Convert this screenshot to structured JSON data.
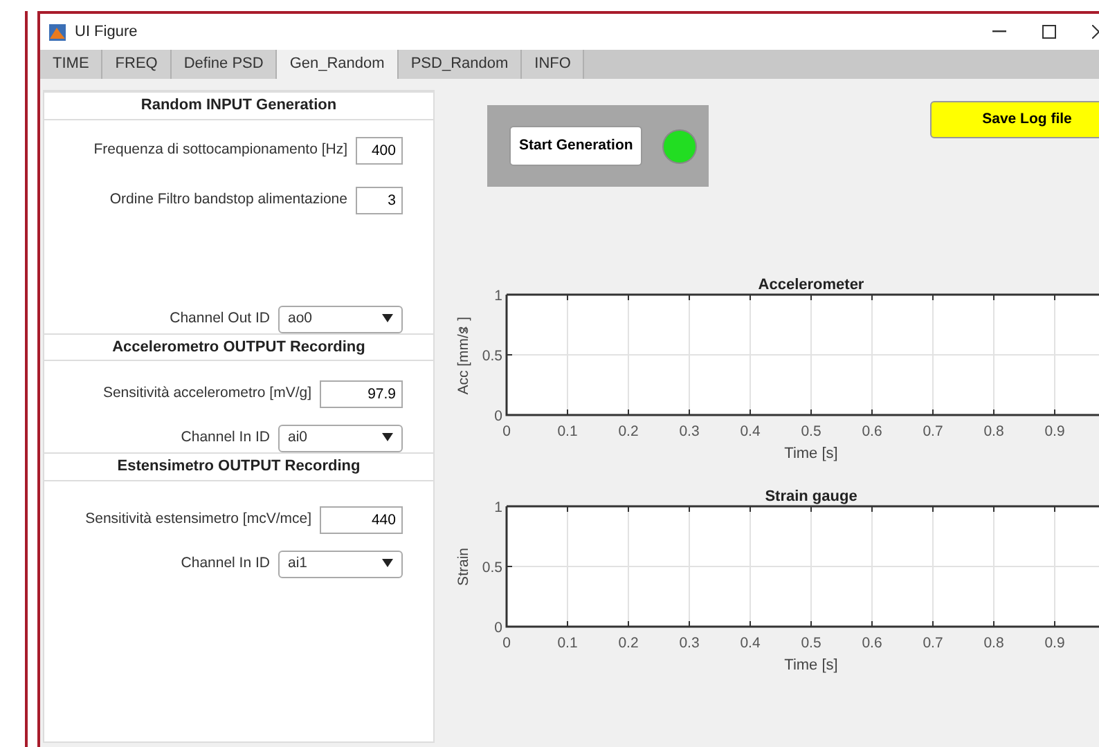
{
  "window": {
    "title": "UI Figure"
  },
  "tabs": [
    {
      "label": "TIME",
      "selected": false
    },
    {
      "label": "FREQ",
      "selected": false
    },
    {
      "label": "Define PSD",
      "selected": false
    },
    {
      "label": "Gen_Random",
      "selected": true
    },
    {
      "label": "PSD_Random",
      "selected": false
    },
    {
      "label": "INFO",
      "selected": false
    }
  ],
  "panels": [
    {
      "title": "Random INPUT Generation",
      "fields": [
        {
          "kind": "number",
          "label": "Frequenza di sottocampionamento [Hz]",
          "value": "400"
        },
        {
          "kind": "number",
          "label": "Ordine Filtro bandstop alimentazione",
          "value": "3"
        },
        {
          "kind": "dropdown",
          "label": "Channel Out ID",
          "value": "ao0"
        }
      ]
    },
    {
      "title": "Accelerometro OUTPUT Recording",
      "fields": [
        {
          "kind": "number",
          "label": "Sensitività accelerometro [mV/g]",
          "value": "97.9"
        },
        {
          "kind": "dropdown",
          "label": "Channel In ID",
          "value": "ai0"
        }
      ]
    },
    {
      "title": "Estensimetro OUTPUT Recording",
      "fields": [
        {
          "kind": "number",
          "label": "Sensitività estensimetro [mcV/mce]",
          "value": "440"
        },
        {
          "kind": "dropdown",
          "label": "Channel In ID",
          "value": "ai1"
        }
      ]
    }
  ],
  "start_button": {
    "label": "Start Generation",
    "lamp_on": true
  },
  "save_button": {
    "label": "Save Log file"
  },
  "charts": [
    {
      "chart_data": {
        "type": "line",
        "title": "Accelerometer",
        "xlabel": "Time [s]",
        "ylabel": "Acc [mm/s$^{2}$]",
        "xlim": [
          0,
          1
        ],
        "ylim": [
          0,
          1
        ],
        "xticks": [
          0,
          0.1,
          0.2,
          0.3,
          0.4,
          0.5,
          0.6,
          0.7,
          0.8,
          0.9
        ],
        "yticks": [
          0,
          0.5,
          1
        ],
        "grid": true
      }
    },
    {
      "chart_data": {
        "type": "line",
        "title": "Strain gauge",
        "xlabel": "Time [s]",
        "ylabel": "Strain",
        "xlim": [
          0,
          1
        ],
        "ylim": [
          0,
          1
        ],
        "xticks": [
          0,
          0.1,
          0.2,
          0.3,
          0.4,
          0.5,
          0.6,
          0.7,
          0.8,
          0.9
        ],
        "yticks": [
          0,
          0.5,
          1
        ],
        "grid": true
      }
    }
  ]
}
